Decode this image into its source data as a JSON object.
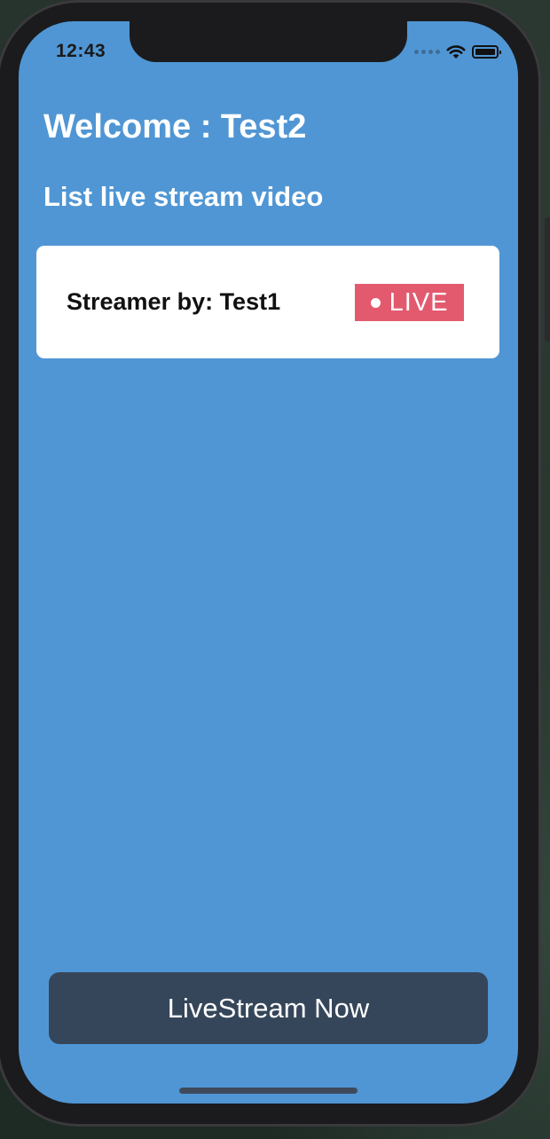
{
  "status_bar": {
    "time": "12:43",
    "icons": [
      "cellular-signal-icon",
      "wifi-icon",
      "battery-icon"
    ]
  },
  "header": {
    "welcome_text": "Welcome : Test2"
  },
  "list": {
    "title": "List live stream video",
    "items": [
      {
        "streamer_label": "Streamer by: Test1",
        "badge": "LIVE"
      }
    ]
  },
  "actions": {
    "livestream_label": "LiveStream Now"
  },
  "colors": {
    "background": "#5096d4",
    "card": "#ffffff",
    "live_badge": "#e35a6e",
    "button": "#36465a",
    "text_light": "#ffffff"
  }
}
